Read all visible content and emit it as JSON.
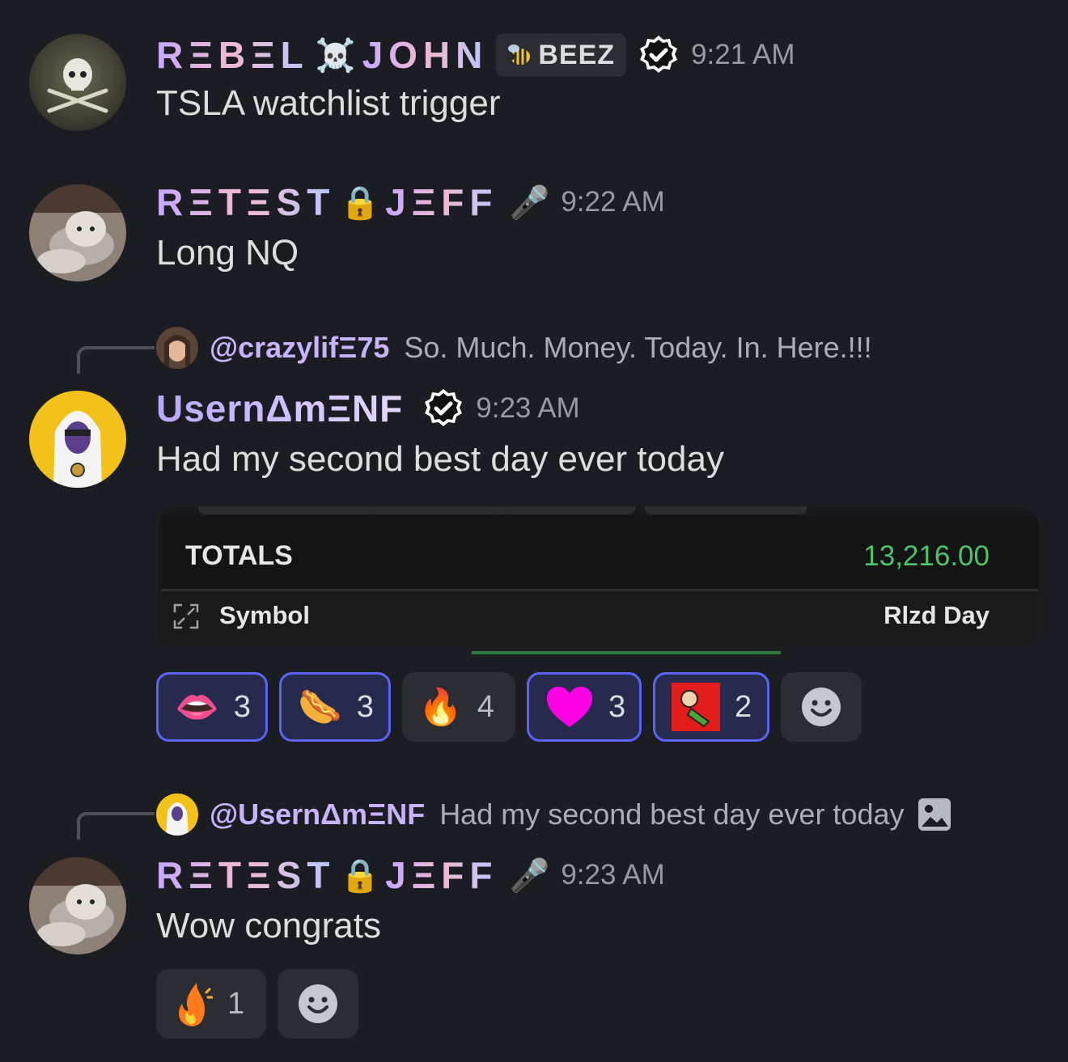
{
  "messages": [
    {
      "username": "RΞBΞL ☠️ JOHN",
      "name_parts": [
        "RΞBΞL",
        "JOHN"
      ],
      "name_emoji": "☠️",
      "tag": "BEEZ",
      "tag_icon": "bee-icon",
      "verified": true,
      "time": "9:21 AM",
      "text": "TSLA watchlist trigger"
    },
    {
      "username": "RΞTΞST🔒JΞFF",
      "name_parts": [
        "RΞTΞST",
        "JΞFF"
      ],
      "name_emoji": "🔒",
      "mic_emoji": "🎤",
      "time": "9:22 AM",
      "text": "Long NQ"
    },
    {
      "reply_to": {
        "name": "@crazylifΞ75",
        "text": "So. Much. Money. Today. In. Here.!!!"
      },
      "username": "UsernΔmΞNF",
      "verified": true,
      "time": "9:23 AM",
      "text": "Had my second best day ever today",
      "embed": {
        "totals_label": "TOTALS",
        "totals_value": "13,216.00",
        "col_symbol": "Symbol",
        "col_rlzd": "Rlzd Day"
      },
      "reactions": [
        {
          "emoji": "👄",
          "count": "3",
          "mine": true
        },
        {
          "emoji": "🌭",
          "count": "3",
          "mine": true
        },
        {
          "emoji": "🔥",
          "count": "4",
          "mine": false
        },
        {
          "emoji": "heart-icon",
          "count": "3",
          "mine": true
        },
        {
          "emoji": "custom-emoji",
          "count": "2",
          "mine": true
        }
      ]
    },
    {
      "reply_to": {
        "name": "@UsernΔmΞNF",
        "text": "Had my second best day ever today",
        "has_image": true
      },
      "username": "RΞTΞST🔒JΞFF",
      "name_parts": [
        "RΞTΞST",
        "JΞFF"
      ],
      "name_emoji": "🔒",
      "mic_emoji": "🎤",
      "time": "9:23 AM",
      "text": "Wow congrats",
      "reactions": [
        {
          "emoji": "animated-fire",
          "count": "1",
          "mine": false
        }
      ]
    }
  ],
  "colors": {
    "background": "#1c1d22",
    "accent": "#5865f2",
    "green": "#4ec36c"
  }
}
